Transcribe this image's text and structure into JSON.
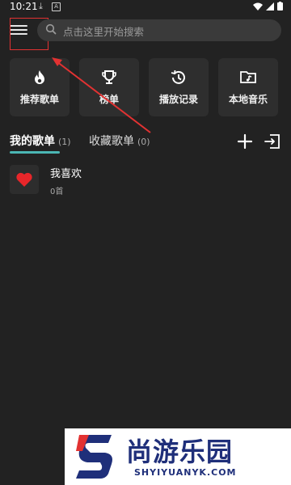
{
  "status": {
    "time": "10:21"
  },
  "search": {
    "placeholder": "点击这里开始搜索"
  },
  "tiles": [
    {
      "label": "推荐歌单",
      "icon": "fire-icon"
    },
    {
      "label": "榜单",
      "icon": "trophy-icon"
    },
    {
      "label": "播放记录",
      "icon": "history-icon"
    },
    {
      "label": "本地音乐",
      "icon": "music-folder-icon"
    }
  ],
  "tabs": {
    "mine": {
      "label": "我的歌单",
      "count": "(1)"
    },
    "fav": {
      "label": "收藏歌单",
      "count": "(0)"
    }
  },
  "playlists": [
    {
      "title": "我喜欢",
      "count": "0首",
      "icon": "heart-icon"
    }
  ],
  "colors": {
    "accent": "#4bb6b4",
    "heart": "#e8262a",
    "annotation": "#e23232",
    "background": "#222222"
  },
  "watermark": {
    "cn": "尚游乐园",
    "en": "SHYIYUANYK.COM"
  }
}
